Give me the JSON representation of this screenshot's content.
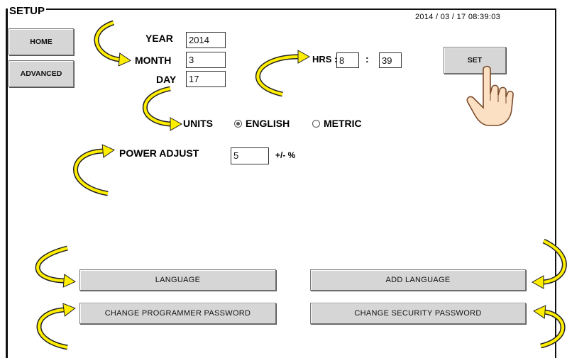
{
  "header": {
    "title": "SETUP",
    "datetime": "2014 / 03 / 17   08:39:03"
  },
  "nav": {
    "home": "HOME",
    "advanced": "ADVANCED"
  },
  "date": {
    "year_label": "YEAR",
    "year_value": "2014",
    "month_label": "MONTH",
    "month_value": "3",
    "day_label": "DAY",
    "day_value": "17"
  },
  "time": {
    "hrs_label": "HRS :",
    "hour_value": "8",
    "separator": ":",
    "minute_value": "39",
    "set_label": "SET"
  },
  "units": {
    "label": "UNITS",
    "english": "ENGLISH",
    "metric": "METRIC",
    "selected": "english"
  },
  "power": {
    "label": "POWER ADJUST",
    "value": "5",
    "unit": "+/- %"
  },
  "buttons": {
    "language": "LANGUAGE",
    "add_language": "ADD LANGUAGE",
    "change_programmer_password": "CHANGE PROGRAMMER PASSWORD",
    "change_security_password": "CHANGE SECURITY PASSWORD"
  },
  "colors": {
    "arrow_fill": "#ffee00",
    "button_face": "#d6d6d6"
  },
  "icons": {
    "pointer": "hand-pointer-icon",
    "callout": "curved-arrow-icon"
  }
}
